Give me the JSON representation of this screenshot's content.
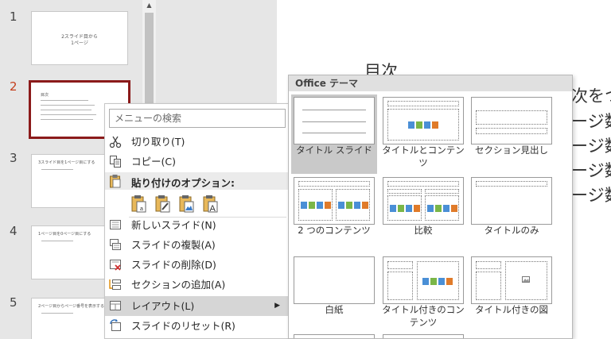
{
  "slides": [
    {
      "num": "1",
      "title_text": "2スライド目から\n1ページ"
    },
    {
      "num": "2",
      "head_text": "目次"
    },
    {
      "num": "3",
      "head_text": "3スライド目を1ページ目にする"
    },
    {
      "num": "4",
      "head_text": "1ページ目を0ページ目にする"
    },
    {
      "num": "5",
      "head_text": "2ページ目からページ番号を表示する"
    }
  ],
  "canvas": {
    "title": "目次",
    "lines": [
      "次をつ",
      "ージ数",
      "ージ数",
      "ージ数",
      "ージ数"
    ]
  },
  "context_menu": {
    "search_placeholder": "メニューの検索",
    "items": {
      "cut": "切り取り(T)",
      "copy": "コピー(C)",
      "paste_options": "貼り付けのオプション:",
      "new_slide": "新しいスライド(N)",
      "duplicate": "スライドの複製(A)",
      "delete": "スライドの削除(D)",
      "add_section": "セクションの追加(A)",
      "layout": "レイアウト(L)",
      "reset": "スライドのリセット(R)"
    }
  },
  "layout_submenu": {
    "header": "Office テーマ",
    "layouts": [
      "タイトル スライド",
      "タイトルとコンテンツ",
      "セクション見出し",
      "2 つのコンテンツ",
      "比較",
      "タイトルのみ",
      "白紙",
      "タイトル付きのコンテンツ",
      "タイトル付きの図"
    ]
  },
  "colors": {
    "selected_slide_border": "#8b1a1a",
    "selected_slide_number": "#c43e1c"
  }
}
